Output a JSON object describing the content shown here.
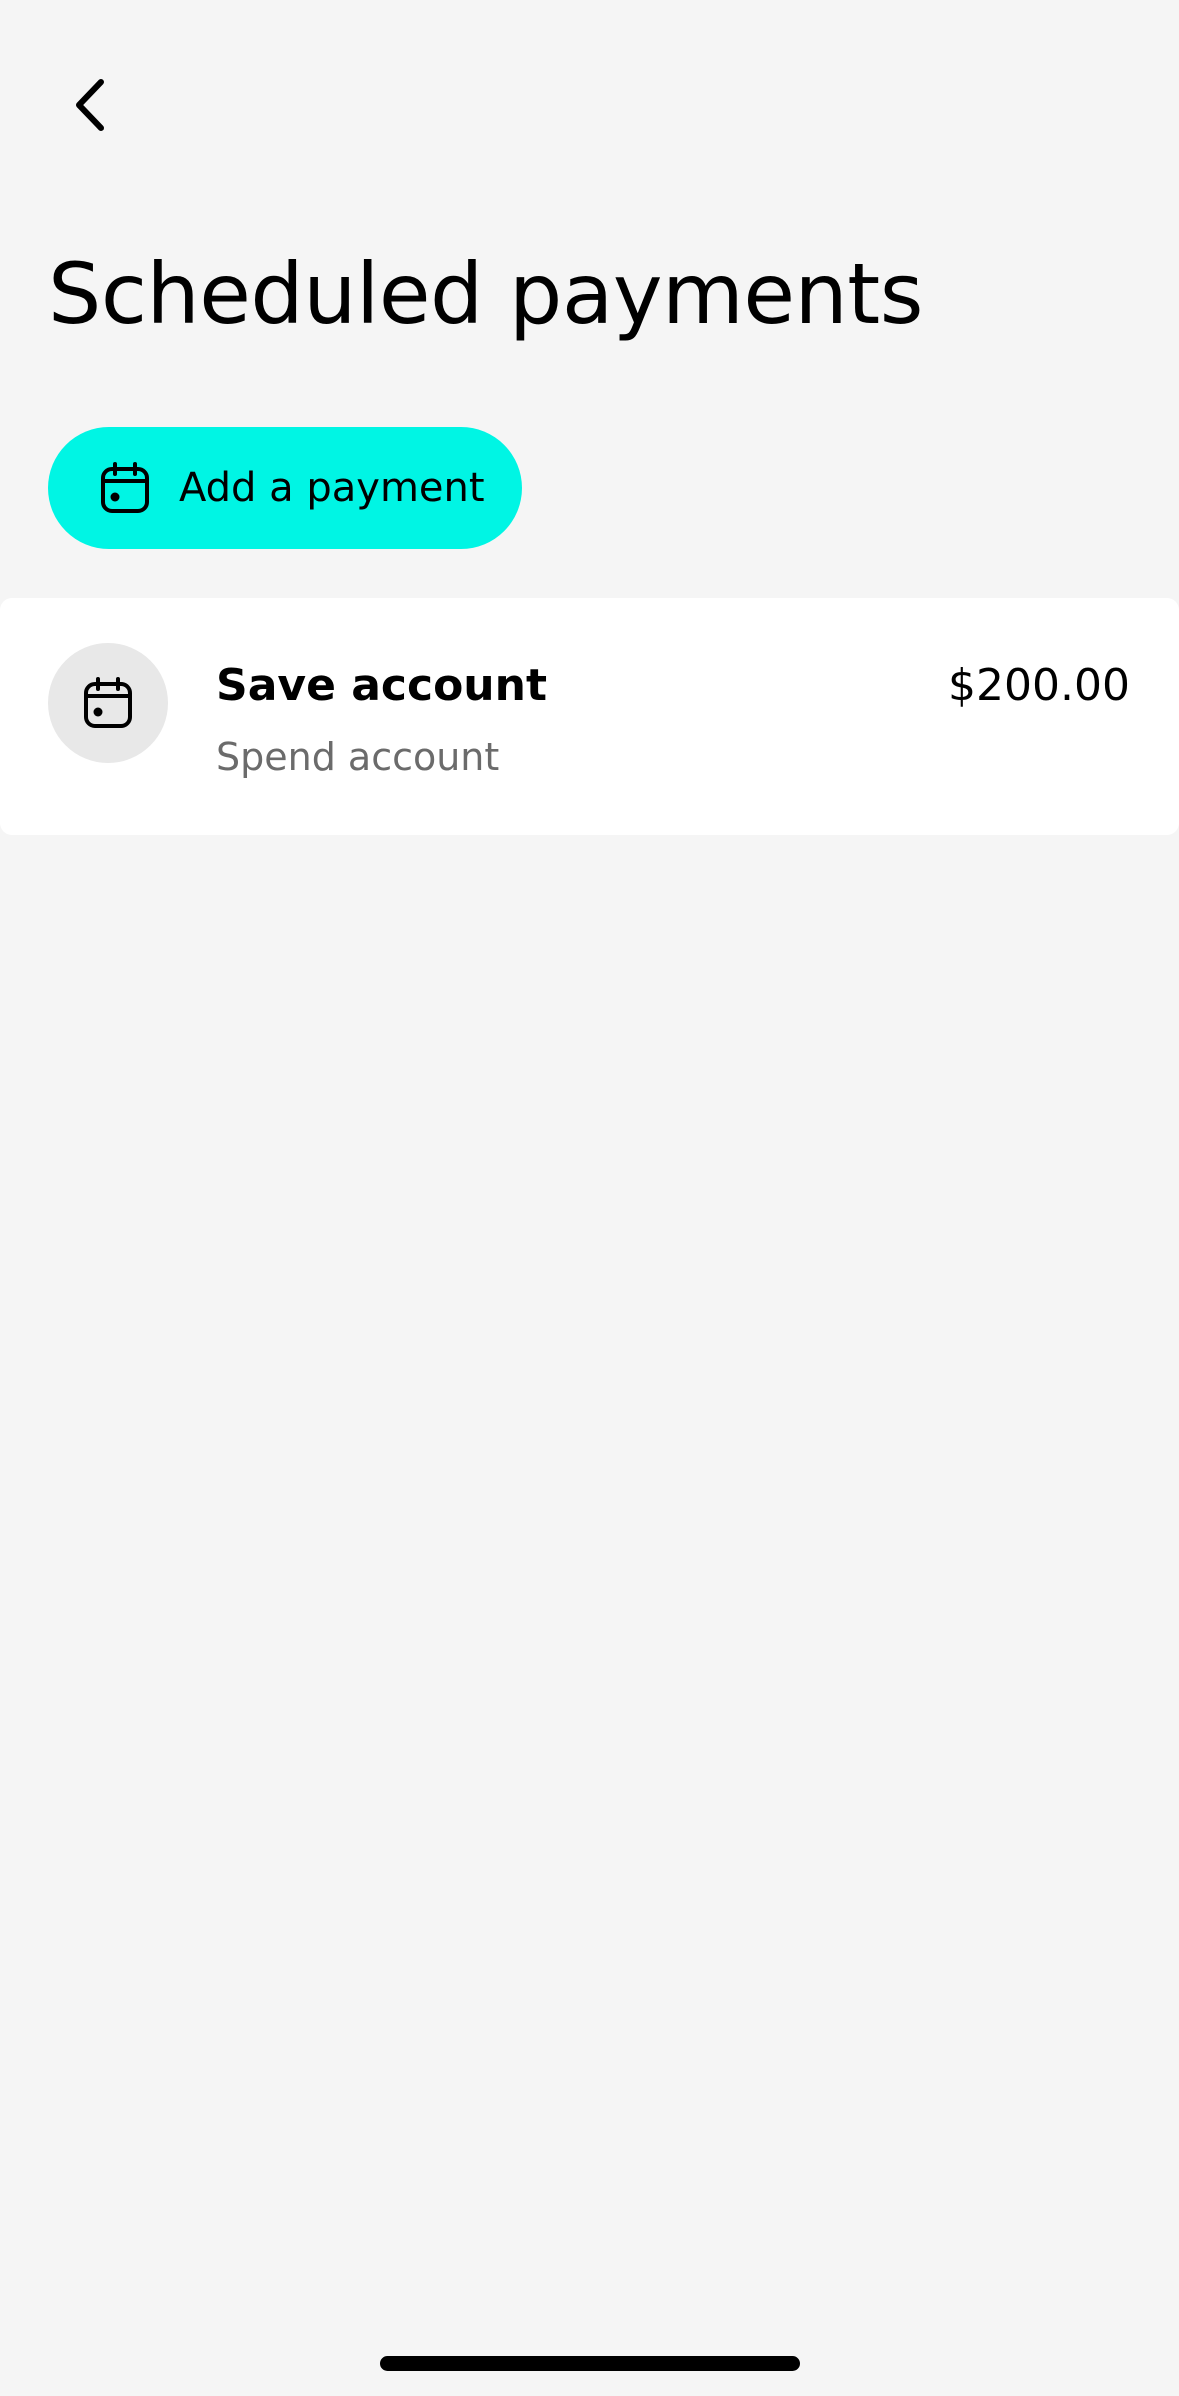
{
  "header": {
    "back_icon": "chevron-left-icon",
    "title": "Scheduled payments"
  },
  "actions": {
    "add_payment_label": "Add a payment",
    "add_payment_icon": "calendar-icon",
    "accent_color": "#00f5e4"
  },
  "payments": [
    {
      "icon": "calendar-icon",
      "title": "Save account",
      "subtitle": "Spend account",
      "amount": "$200.00"
    }
  ]
}
